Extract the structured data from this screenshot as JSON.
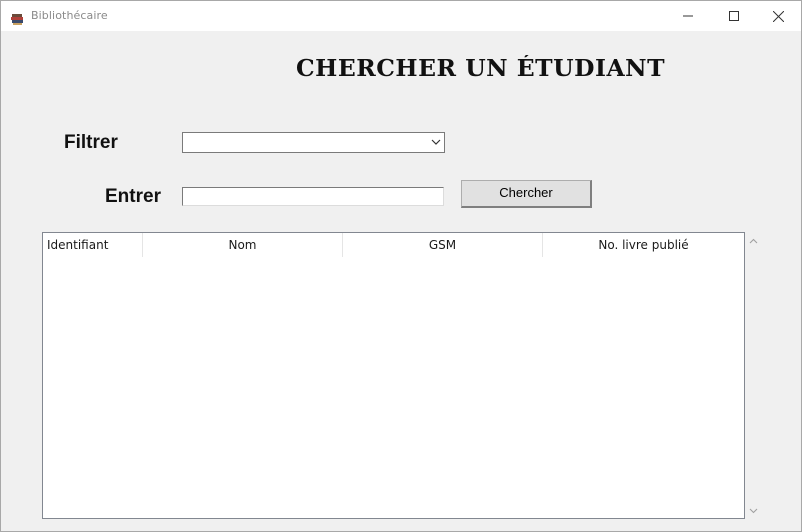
{
  "window": {
    "title": "Bibliothécaire",
    "icon": "book-stack-icon",
    "controls": {
      "minimize": "minimize-icon",
      "maximize": "maximize-icon",
      "close": "close-icon"
    }
  },
  "main": {
    "heading": "CHERCHER UN ÉTUDIANT",
    "filter": {
      "label": "Filtrer",
      "selected_value": ""
    },
    "entry": {
      "label": "Entrer",
      "value": "",
      "placeholder": ""
    },
    "search_button_label": "Chercher"
  },
  "table": {
    "columns": [
      "Identifiant",
      "Nom",
      "GSM",
      "No. livre publié"
    ],
    "rows": []
  }
}
